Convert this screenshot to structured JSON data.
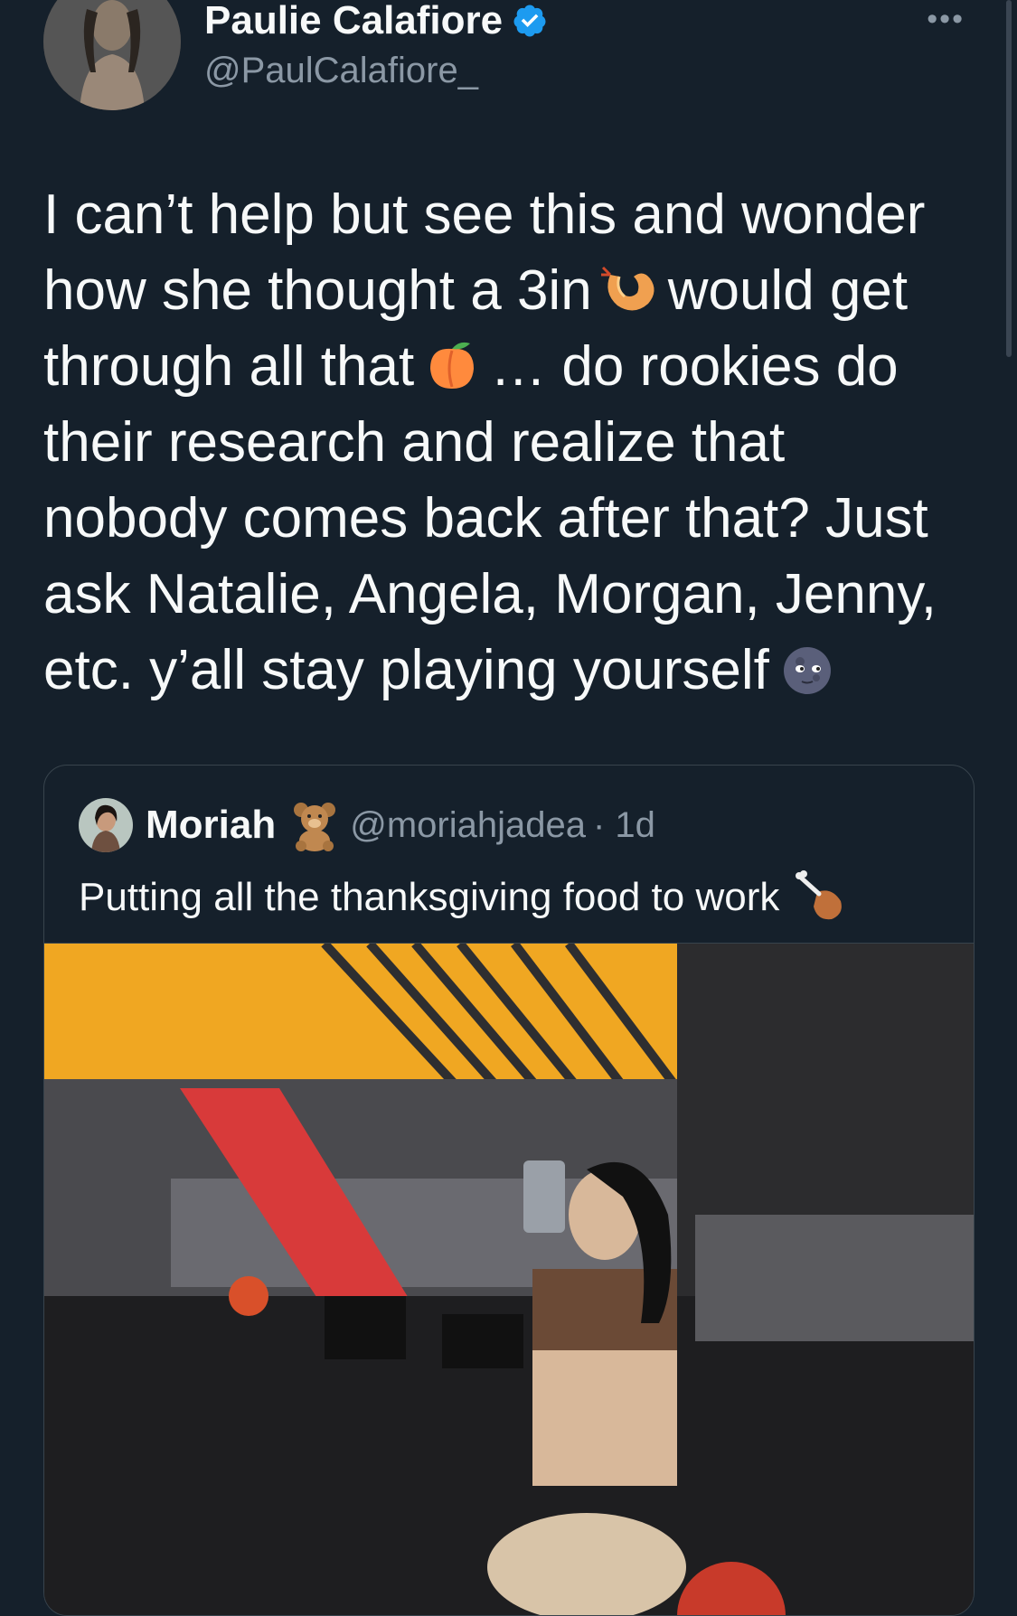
{
  "tweet": {
    "author_name": "Paulie Calafiore",
    "author_handle": "@PaulCalafiore_",
    "verified": true,
    "text": "I can’t help but see this and wonder how she thought a 3in {shrimp} would get through all that {peach}… do rookies do their research and realize that nobody comes back after that? Just ask Natalie, Angela, Morgan, Jenny, etc. y’all stay playing yourself {moon}",
    "text_line1": "I can’t help but see this and wonder",
    "text_line2a": "how she thought a 3in",
    "text_line2b": "would get",
    "text_line3a": "through all that",
    "text_line3b": "… do rookies do",
    "text_line4": "their research and realize that",
    "text_line5": "nobody comes back after that? Just",
    "text_line6": "ask Natalie, Angela, Morgan, Jenny,",
    "text_line7": "etc. y’all stay playing yourself",
    "emojis": [
      "shrimp-emoji",
      "peach-emoji",
      "new-moon-face-emoji"
    ],
    "more_label": "•••"
  },
  "quoted_tweet": {
    "author_name": "Moriah",
    "author_emoji": "teddy-bear-emoji",
    "author_handle": "@moriahjadea",
    "time": "· 1d",
    "text": "Putting all the thanksgiving food to work",
    "text_emoji": "poultry-leg-emoji",
    "photo": "gym-mirror-selfie-image"
  },
  "colors": {
    "background": "#15202b",
    "text": "#f7f9f9",
    "secondary": "#8b98a5",
    "verified": "#1d9bf0",
    "border": "#38444d"
  }
}
